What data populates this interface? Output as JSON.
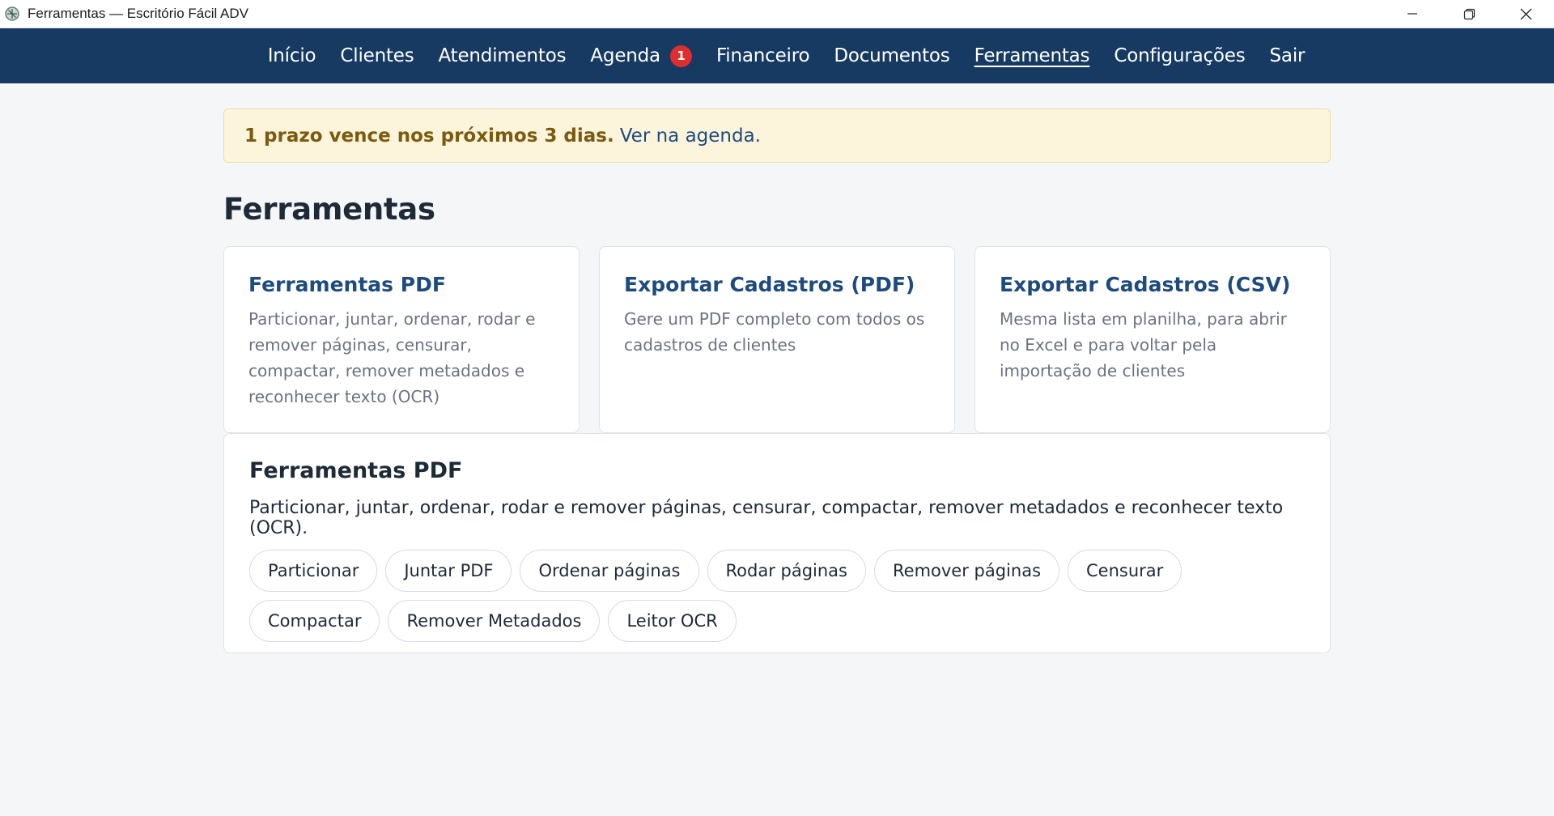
{
  "window": {
    "title": "Ferramentas — Escritório Fácil ADV"
  },
  "nav": {
    "items": [
      {
        "label": "Início"
      },
      {
        "label": "Clientes"
      },
      {
        "label": "Atendimentos"
      },
      {
        "label": "Agenda",
        "badge": "1"
      },
      {
        "label": "Financeiro"
      },
      {
        "label": "Documentos"
      },
      {
        "label": "Ferramentas",
        "active": true
      },
      {
        "label": "Configurações"
      },
      {
        "label": "Sair"
      }
    ]
  },
  "alert": {
    "strong": "1 prazo vence nos próximos 3 dias.",
    "link": "Ver na agenda."
  },
  "page": {
    "title": "Ferramentas"
  },
  "cards": [
    {
      "title": "Ferramentas PDF",
      "desc": "Particionar, juntar, ordenar, rodar e remover páginas, censurar, compactar, remover metadados e reconhecer texto (OCR)"
    },
    {
      "title": "Exportar Cadastros (PDF)",
      "desc": "Gere um PDF completo com todos os cadastros de clientes"
    },
    {
      "title": "Exportar Cadastros (CSV)",
      "desc": "Mesma lista em planilha, para abrir no Excel e para voltar pela importação de clientes"
    }
  ],
  "pdf_panel": {
    "title": "Ferramentas PDF",
    "desc": "Particionar, juntar, ordenar, rodar e remover páginas, censurar, compactar, remover metadados e reconhecer texto (OCR).",
    "tools": [
      "Particionar",
      "Juntar PDF",
      "Ordenar páginas",
      "Rodar páginas",
      "Remover páginas",
      "Censurar",
      "Compactar",
      "Remover Metadados",
      "Leitor OCR"
    ]
  },
  "colors": {
    "nav_bg": "#173a63",
    "accent": "#1e4b7e",
    "badge": "#e02d2d",
    "alert_bg": "#fdf4dc"
  }
}
